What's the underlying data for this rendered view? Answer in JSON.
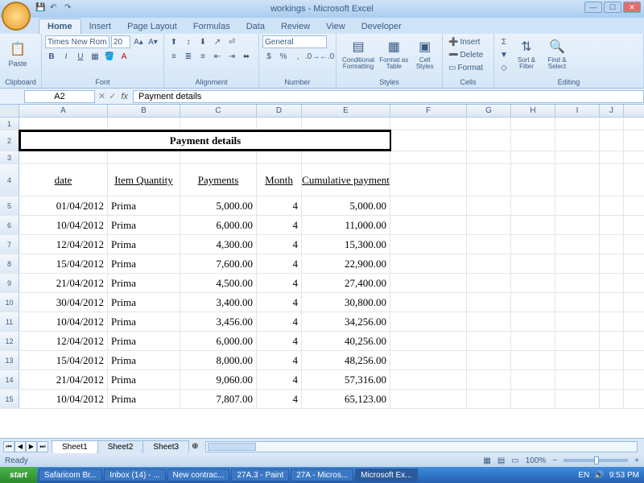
{
  "window": {
    "title": "workings - Microsoft Excel"
  },
  "tabs": [
    "Home",
    "Insert",
    "Page Layout",
    "Formulas",
    "Data",
    "Review",
    "View",
    "Developer"
  ],
  "ribbon": {
    "clipboard": {
      "label": "Clipboard",
      "paste": "Paste"
    },
    "font": {
      "label": "Font",
      "name": "Times New Rom",
      "size": "20",
      "bold": "B",
      "italic": "I",
      "underline": "U"
    },
    "alignment": {
      "label": "Alignment"
    },
    "number": {
      "label": "Number",
      "format": "General",
      "currency": "$",
      "percent": "%",
      "comma": ","
    },
    "styles": {
      "label": "Styles",
      "cond": "Conditional Formatting",
      "table": "Format as Table",
      "cell": "Cell Styles"
    },
    "cells": {
      "label": "Cells",
      "insert": "Insert",
      "delete": "Delete",
      "format": "Format"
    },
    "editing": {
      "label": "Editing",
      "sort": "Sort & Filter",
      "find": "Find & Select"
    }
  },
  "namebox": "A2",
  "formula": "Payment details",
  "columns": [
    "A",
    "B",
    "C",
    "D",
    "E",
    "F",
    "G",
    "H",
    "I",
    "J"
  ],
  "title_merged": "Payment details",
  "headers": {
    "A": "date",
    "B": "Item Quantity",
    "C": "Payments",
    "D": "Month",
    "E": "Cumulative payment"
  },
  "rows": [
    {
      "n": 5,
      "date": "01/04/2012",
      "item": "Prima",
      "pay": "5,000.00",
      "month": "4",
      "cum": "5,000.00"
    },
    {
      "n": 6,
      "date": "10/04/2012",
      "item": "Prima",
      "pay": "6,000.00",
      "month": "4",
      "cum": "11,000.00"
    },
    {
      "n": 7,
      "date": "12/04/2012",
      "item": "Prima",
      "pay": "4,300.00",
      "month": "4",
      "cum": "15,300.00"
    },
    {
      "n": 8,
      "date": "15/04/2012",
      "item": "Prima",
      "pay": "7,600.00",
      "month": "4",
      "cum": "22,900.00"
    },
    {
      "n": 9,
      "date": "21/04/2012",
      "item": "Prima",
      "pay": "4,500.00",
      "month": "4",
      "cum": "27,400.00"
    },
    {
      "n": 10,
      "date": "30/04/2012",
      "item": "Prima",
      "pay": "3,400.00",
      "month": "4",
      "cum": "30,800.00"
    },
    {
      "n": 11,
      "date": "10/04/2012",
      "item": "Prima",
      "pay": "3,456.00",
      "month": "4",
      "cum": "34,256.00"
    },
    {
      "n": 12,
      "date": "12/04/2012",
      "item": "Prima",
      "pay": "6,000.00",
      "month": "4",
      "cum": "40,256.00"
    },
    {
      "n": 13,
      "date": "15/04/2012",
      "item": "Prima",
      "pay": "8,000.00",
      "month": "4",
      "cum": "48,256.00"
    },
    {
      "n": 14,
      "date": "21/04/2012",
      "item": "Prima",
      "pay": "9,060.00",
      "month": "4",
      "cum": "57,316.00"
    },
    {
      "n": 15,
      "date": "10/04/2012",
      "item": "Prima",
      "pay": "7,807.00",
      "month": "4",
      "cum": "65,123.00"
    }
  ],
  "sheets": [
    "Sheet1",
    "Sheet2",
    "Sheet3"
  ],
  "status": {
    "ready": "Ready",
    "zoom": "100%"
  },
  "taskbar": {
    "start": "start",
    "items": [
      "Safaricom Br...",
      "Inbox (14) - ...",
      "New contrac...",
      "27A.3 - Paint",
      "27A - Micros...",
      "Microsoft Ex..."
    ],
    "lang": "EN",
    "time": "9:53 PM"
  }
}
